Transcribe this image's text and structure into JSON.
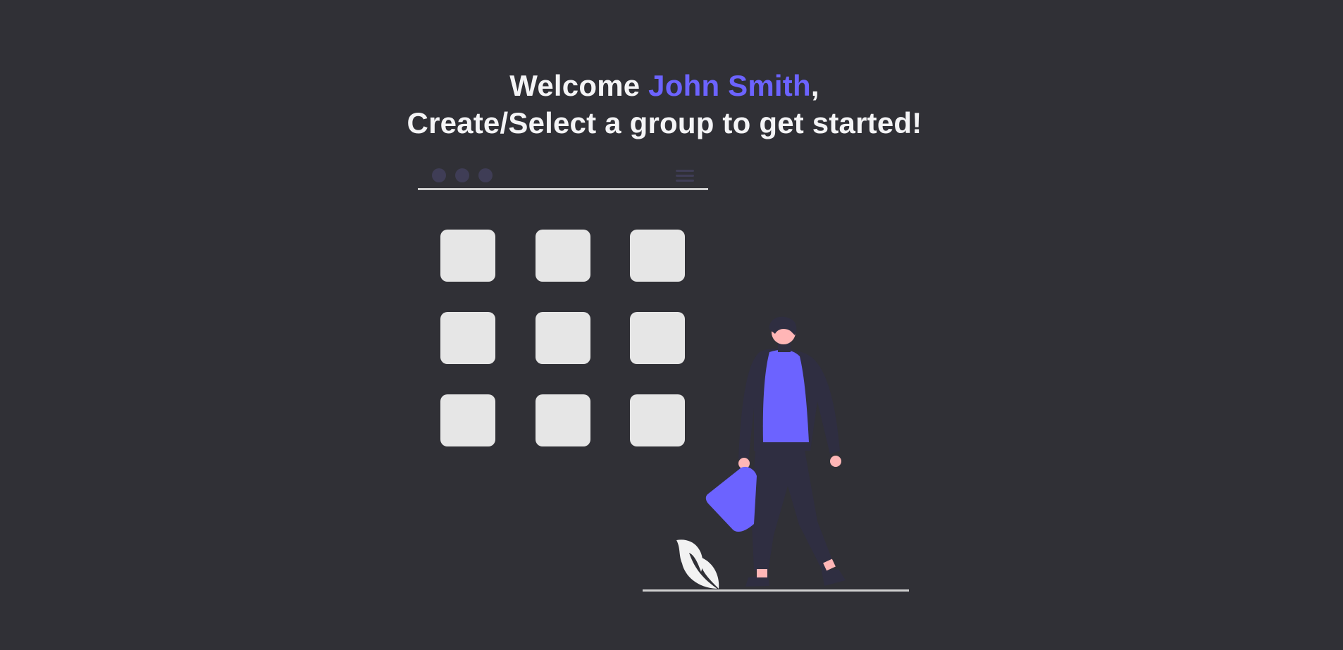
{
  "welcome": {
    "greeting": "Welcome",
    "user_name": "John Smith",
    "comma": ",",
    "subtitle": "Create/Select a group to get started!"
  },
  "colors": {
    "background": "#303036",
    "accent": "#6c63ff",
    "heading_text": "#f4f4f6",
    "tile": "#e6e6e6"
  },
  "illustration": {
    "window_dots": [
      "dot",
      "dot",
      "dot"
    ],
    "menu_icon": "hamburger-menu-icon",
    "group_tiles": [
      {
        "id": "tile-1"
      },
      {
        "id": "tile-2"
      },
      {
        "id": "tile-3"
      },
      {
        "id": "tile-4"
      },
      {
        "id": "tile-5"
      },
      {
        "id": "tile-6"
      },
      {
        "id": "tile-7"
      },
      {
        "id": "tile-8"
      },
      {
        "id": "tile-9"
      }
    ]
  }
}
